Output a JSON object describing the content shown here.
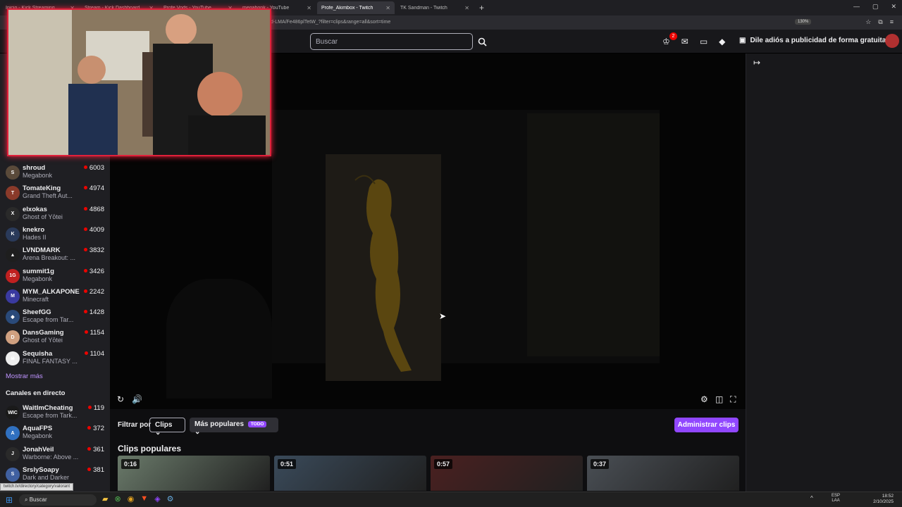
{
  "browser": {
    "tabs": [
      {
        "title": "Inicio - Kick Streaming",
        "active": false
      },
      {
        "title": "Stream - Kick Dashboard",
        "active": false
      },
      {
        "title": "Profe Vods - YouTube",
        "active": false
      },
      {
        "title": "megabonk - YouTube",
        "active": false
      },
      {
        "title": "Profe_Akimbox - Twitch",
        "active": true
      },
      {
        "title": "TK Sandman - Twitch",
        "active": false
      }
    ],
    "url": "d-LMA/Fe486plTetW_?filter=clips&range=all&sort=time",
    "zoom": "130%"
  },
  "topnav": {
    "search_placeholder": "Buscar",
    "notifications_count": "2",
    "promo_text": "Dile adiós a publicidad de forma gratuita"
  },
  "sidebar": {
    "channels": [
      {
        "name": "shroud",
        "game": "Megabonk",
        "viewers": "6003",
        "avatar_color": "#5a4a3a",
        "icon": "S"
      },
      {
        "name": "TomateKing",
        "game": "Grand Theft Aut...",
        "viewers": "4974",
        "avatar_color": "#8a3a2a",
        "icon": "T"
      },
      {
        "name": "elxokas",
        "game": "Ghost of Yōtei",
        "viewers": "4868",
        "avatar_color": "#2a2a2a",
        "icon": "X"
      },
      {
        "name": "knekro",
        "game": "Hades II",
        "viewers": "4009",
        "avatar_color": "#2a3a5a",
        "icon": "K"
      },
      {
        "name": "LVNDMARK",
        "game": "Arena Breakout: ...",
        "viewers": "3832",
        "avatar_color": "#1e1e1e",
        "icon": "▲"
      },
      {
        "name": "summit1g",
        "game": "Megabonk",
        "viewers": "3426",
        "avatar_color": "#c02020",
        "icon": "1G"
      },
      {
        "name": "MYM_ALKAPONE",
        "game": "Minecraft",
        "viewers": "2242",
        "avatar_color": "#3a3aa0",
        "icon": "M"
      },
      {
        "name": "SheefGG",
        "game": "Escape from Tar...",
        "viewers": "1428",
        "avatar_color": "#2a4a7a",
        "icon": "◆"
      },
      {
        "name": "DansGaming",
        "game": "Ghost of Yōtei",
        "viewers": "1154",
        "avatar_color": "#d0a080",
        "icon": "D"
      },
      {
        "name": "Sequisha",
        "game": "FINAL FANTASY ...",
        "viewers": "1104",
        "avatar_color": "#eeeeee",
        "icon": "☠"
      }
    ],
    "show_more": "Mostrar más",
    "live_section_title": "Canales en directo",
    "live_channels": [
      {
        "name": "WaitImCheating",
        "game": "Escape from Tark...",
        "viewers": "119",
        "avatar_color": "#1a1a1a",
        "icon": "WIC"
      },
      {
        "name": "AquaFPS",
        "game": "Megabonk",
        "viewers": "372",
        "avatar_color": "#3070c0",
        "icon": "A"
      },
      {
        "name": "JonahVeil",
        "game": "Warborne: Above ...",
        "viewers": "361",
        "avatar_color": "#2a2a2a",
        "icon": "J"
      },
      {
        "name": "SrslySoapy",
        "game": "Dark and Darker",
        "viewers": "381",
        "avatar_color": "#4060a0",
        "icon": "S"
      }
    ],
    "status_url": "twitch.tv/directory/category/valorant"
  },
  "filters": {
    "label": "Filtrar por",
    "type_value": "Clips",
    "sort_value": "Más populares",
    "range_badge": "TODO"
  },
  "admin_button": "Administrar clips",
  "clips_section_title": "Clips populares",
  "clips": [
    {
      "duration": "0:16",
      "thumb_color": "#6a7a6a"
    },
    {
      "duration": "0:51",
      "thumb_color": "#3a4a5a"
    },
    {
      "duration": "0:57",
      "thumb_color": "#4a2020"
    },
    {
      "duration": "0:37",
      "thumb_color": "#4a4f55"
    }
  ],
  "taskbar": {
    "search_text": "Buscar",
    "lang_line1": "ESP",
    "lang_line2": "LAA",
    "time": "18:52",
    "date": "2/10/2025"
  }
}
